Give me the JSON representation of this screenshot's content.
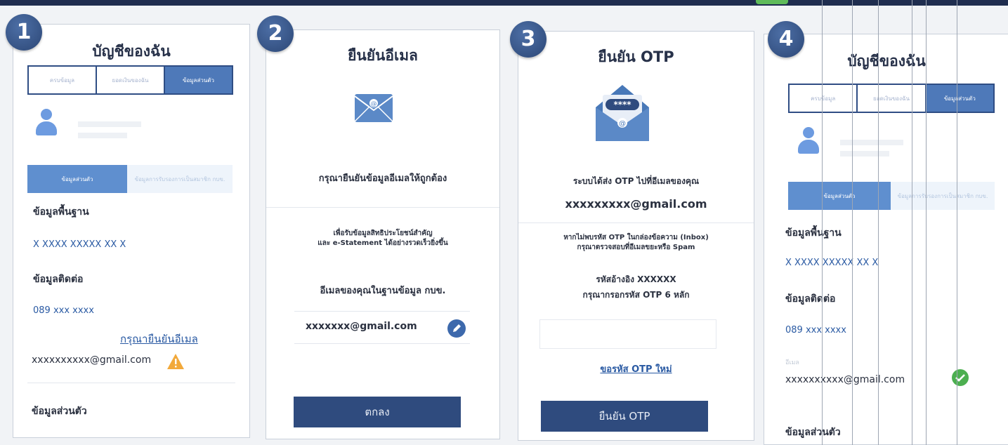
{
  "step_numbers": [
    "1",
    "2",
    "3",
    "4"
  ],
  "step1": {
    "title": "บัญชีของฉัน",
    "tabs": [
      "ครบข้อมูล",
      "ยอดเงินของฉัน",
      "ข้อมูลส่วนตัว"
    ],
    "subtabs": [
      "ข้อมูลส่วนตัว",
      "ข้อมูลการรับรองการเป็นสมาชิก กบข."
    ],
    "basic_heading": "ข้อมูลพื้นฐาน",
    "id_value": "X XXXX XXXXX XX X",
    "contact_heading": "ข้อมูลติดต่อ",
    "phone_value": "089 xxx xxxx",
    "verify_link": "กรุณายืนยันอีเมล",
    "email_value": "xxxxxxxxxx@gmail.com",
    "personal_heading": "ข้อมูลส่วนตัว"
  },
  "step2": {
    "title": "ยืนยันอีเมล",
    "prompt": "กรุณายืนยันข้อมูลอีเมลให้ถูกต้อง",
    "benefit_line1": "เพื่อรับข้อมูลสิทธิประโยชน์สำคัญ",
    "benefit_line2": "และ e-Statement ได้อย่างรวดเร็วยิ่งขึ้น",
    "db_label": "อีเมลของคุณในฐานข้อมูล กบข.",
    "email_value": "xxxxxxx@gmail.com",
    "ok_button": "ตกลง"
  },
  "step3": {
    "title": "ยืนยัน OTP",
    "envelope_code": "****",
    "sent_text": "ระบบได้ส่ง OTP ไปที่อีเมลของคุณ",
    "email_value": "xxxxxxxxx@gmail.com",
    "spam_line1": "หากไม่พบรหัส OTP ในกล่องข้อความ (Inbox)",
    "spam_line2": "กรุณาตรวจสอบที่อีเมลขยะหรือ Spam",
    "ref_text": "รหัสอ้างอิง  XXXXXX",
    "enter_text": "กรุณากรอกรหัส OTP 6 หลัก",
    "resend_link": "ขอรหัส OTP ใหม่",
    "confirm_button": "ยืนยัน OTP"
  },
  "step4": {
    "title": "บัญชีของฉัน",
    "tabs": [
      "ครบข้อมูล",
      "ยอดเงินของฉัน",
      "ข้อมูลส่วนตัว"
    ],
    "subtabs": [
      "ข้อมูลส่วนตัว",
      "ข้อมูลการรับรองการเป็นสมาชิก กบข."
    ],
    "basic_heading": "ข้อมูลพื้นฐาน",
    "id_value": "X XXXX XXXXX XX X",
    "contact_heading": "ข้อมูลติดต่อ",
    "phone_value": "089 xxx xxxx",
    "email_label": "อีเมล",
    "email_value": "xxxxxxxxxx@gmail.com",
    "personal_heading": "ข้อมูลส่วนตัว"
  },
  "colors": {
    "navy": "#2f4b7e",
    "accent": "#4e79b9",
    "warning": "#f2a93b",
    "success": "#4caf50"
  },
  "icons": [
    "user-avatar-icon",
    "email-envelope-icon",
    "otp-envelope-icon",
    "edit-pencil-icon",
    "warning-icon",
    "check-circle-icon"
  ]
}
